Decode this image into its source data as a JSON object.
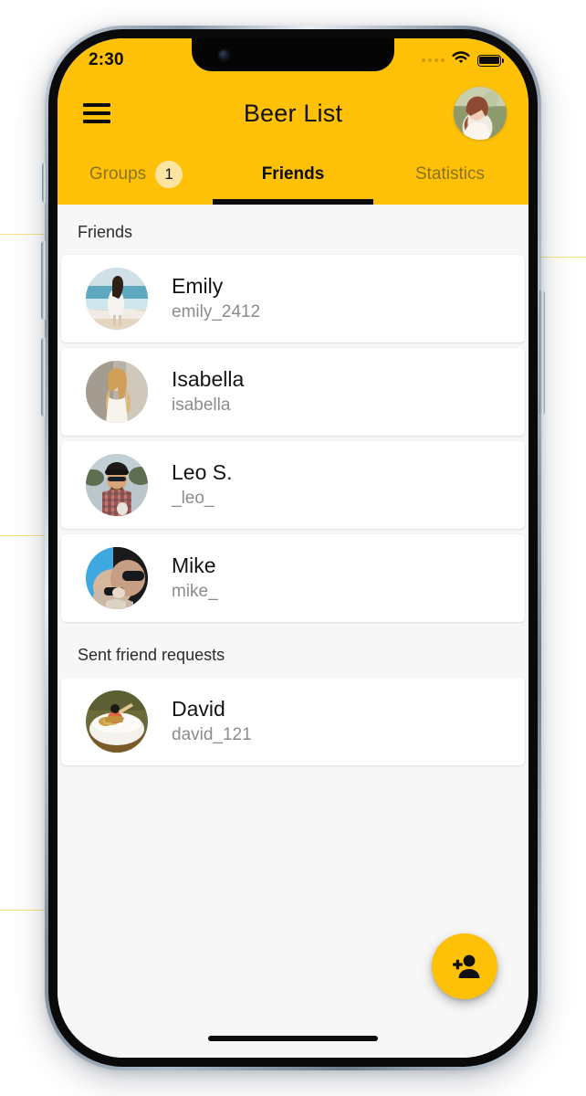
{
  "status_bar": {
    "time": "2:30",
    "signal_icon": "signal-dots-icon",
    "wifi_icon": "wifi-icon",
    "battery_icon": "battery-full-icon"
  },
  "app_bar": {
    "menu_icon": "hamburger-menu-icon",
    "title": "Beer List",
    "avatar_icon": "user-profile-avatar"
  },
  "tabs": [
    {
      "label": "Groups",
      "badge": "1",
      "active": false
    },
    {
      "label": "Friends",
      "badge": null,
      "active": true
    },
    {
      "label": "Statistics",
      "badge": null,
      "active": false
    }
  ],
  "sections": [
    {
      "title": "Friends",
      "rows": [
        {
          "name": "Emily",
          "handle": "emily_2412",
          "avatar": "avatar-emily"
        },
        {
          "name": "Isabella",
          "handle": "isabella",
          "avatar": "avatar-isabella"
        },
        {
          "name": "Leo S.",
          "handle": "_leo_",
          "avatar": "avatar-leo"
        },
        {
          "name": "Mike",
          "handle": "mike_",
          "avatar": "avatar-mike"
        }
      ]
    },
    {
      "title": "Sent friend requests",
      "rows": [
        {
          "name": "David",
          "handle": "david_121",
          "avatar": "avatar-david"
        }
      ]
    }
  ],
  "fab": {
    "icon": "person-add-icon",
    "label": "Add friend"
  },
  "colors": {
    "accent": "#FFC107",
    "badge_bg": "#FCE4A1",
    "tab_inactive_text": "#8A7221",
    "tab_active_text": "#0C0C0C",
    "card_bg": "#FFFFFF",
    "page_bg": "#F7F7F7",
    "name_text": "#141414",
    "handle_text": "#8C8C8C"
  }
}
